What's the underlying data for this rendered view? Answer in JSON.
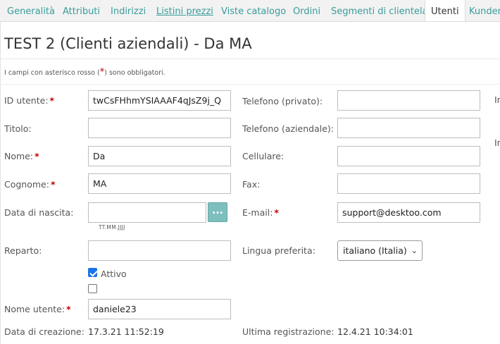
{
  "tabs": [
    {
      "label": "Generalità"
    },
    {
      "label": "Attributi"
    },
    {
      "label": "Indirizzi"
    },
    {
      "label": "Listini prezzi"
    },
    {
      "label": "Viste catalogo"
    },
    {
      "label": "Ordini"
    },
    {
      "label": "Segmenti di clientela"
    },
    {
      "label": "Utenti"
    },
    {
      "label": "Kunden"
    }
  ],
  "active_tab": "Utenti",
  "page_title": "TEST 2 (Clienti aziendali) - Da MA",
  "required_note": {
    "before": "I campi con asterisco rosso (",
    "star": "*",
    "after": ") sono obbligatori."
  },
  "form": {
    "id_utente": {
      "label": "ID utente:",
      "required_mark": "*",
      "value": "twCsFHhmYSIAAAF4qJsZ9j_Q"
    },
    "titolo": {
      "label": "Titolo:",
      "value": ""
    },
    "nome": {
      "label": "Nome:",
      "required_mark": "*",
      "value": "Da"
    },
    "cognome": {
      "label": "Cognome:",
      "required_mark": "*",
      "value": "MA"
    },
    "data_nascita": {
      "label": "Data di nascita:",
      "value": "",
      "button_label": "...",
      "hint": "TT.MM.JJJJ"
    },
    "reparto": {
      "label": "Reparto:",
      "value": ""
    },
    "attivo": {
      "label": "Attivo",
      "checked": true
    },
    "second_checkbox": {
      "checked": false
    },
    "nome_utente": {
      "label": "Nome utente:",
      "required_mark": "*",
      "value": "daniele23"
    },
    "data_creazione": {
      "label": "Data di creazione:",
      "value": "17.3.21 11:52:19"
    },
    "telefono_privato": {
      "label": "Telefono (privato):",
      "value": ""
    },
    "telefono_aziendale": {
      "label": "Telefono (aziendale):",
      "value": ""
    },
    "cellulare": {
      "label": "Cellulare:",
      "value": ""
    },
    "fax": {
      "label": "Fax:",
      "value": ""
    },
    "email": {
      "label": "E-mail:",
      "required_mark": "*",
      "value": "support@desktoo.com"
    },
    "lingua": {
      "label": "Lingua preferita:",
      "value": "italiano (Italia)"
    },
    "ultima_registrazione": {
      "label": "Ultima registrazione:",
      "value": "12.4.21 10:34:01"
    },
    "clipped_label_1": "In",
    "clipped_label_2": "In"
  },
  "colors": {
    "accent": "#3a9c9c",
    "required": "#c00000",
    "button": "#7ebfbe",
    "checkbox": "#1a73e8"
  }
}
